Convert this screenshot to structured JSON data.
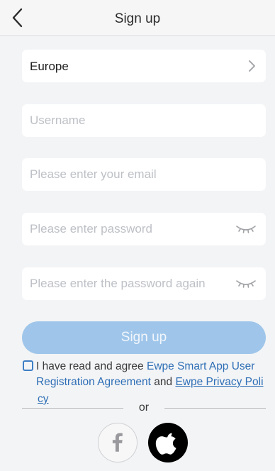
{
  "header": {
    "title": "Sign up",
    "back_icon": "chevron-left-icon"
  },
  "region": {
    "value": "Europe",
    "icon": "chevron-right-icon"
  },
  "username": {
    "placeholder": "Username",
    "value": ""
  },
  "email": {
    "placeholder": "Please enter your email",
    "value": ""
  },
  "password": {
    "placeholder": "Please enter password",
    "value": "",
    "icon": "eye-closed-icon"
  },
  "password_confirm": {
    "placeholder": "Please enter the password again",
    "value": "",
    "icon": "eye-closed-icon"
  },
  "signup_button": {
    "label": "Sign up"
  },
  "agreement": {
    "checked": false,
    "prefix": "I have read and agree ",
    "link1": "Ewpe Smart App User Registration Agreement",
    "middle": " and ",
    "link2": "Ewpe Privacy Poli",
    "link2_tail": "cy"
  },
  "divider": {
    "text": "or"
  },
  "social": {
    "facebook_icon": "facebook-icon",
    "apple_icon": "apple-icon"
  },
  "colors": {
    "background": "#f3f4f6",
    "field": "#ffffff",
    "button": "#9fc6ea",
    "link": "#2f6fb6",
    "checkbox": "#3d7fc5",
    "placeholder": "#bdc0c6"
  }
}
